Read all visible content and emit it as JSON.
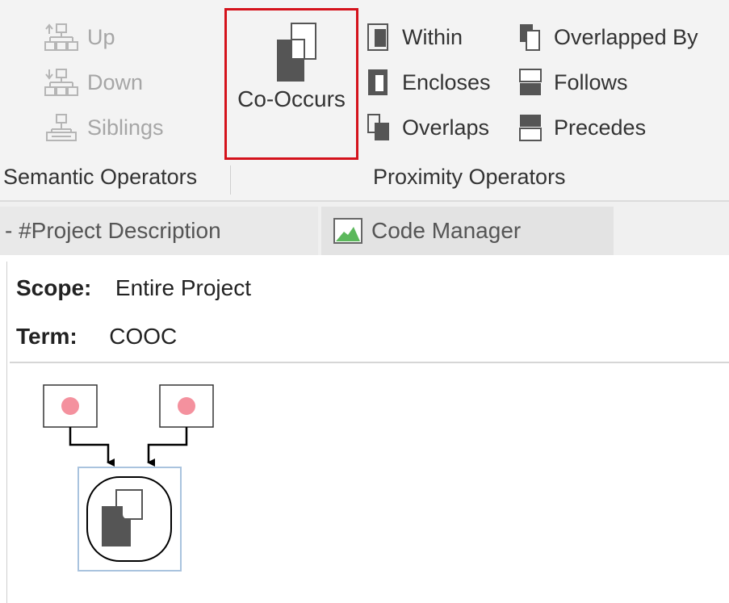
{
  "ribbon": {
    "semantic": {
      "group_label": "Semantic Operators",
      "up_label": "Up",
      "down_label": "Down",
      "siblings_label": "Siblings"
    },
    "proximity": {
      "group_label": "Proximity Operators",
      "cooccurs_label": "Co-Occurs",
      "within_label": "Within",
      "encloses_label": "Encloses",
      "overlaps_label": "Overlaps",
      "overlapped_by_label": "Overlapped By",
      "follows_label": "Follows",
      "precedes_label": "Precedes"
    }
  },
  "tabs": [
    {
      "label": "- #Project Description"
    },
    {
      "label": "Code Manager",
      "icon": "code-manager-icon"
    }
  ],
  "query": {
    "scope_key": "Scope:",
    "scope_value": "Entire Project",
    "term_key": "Term:",
    "term_value": "COOC"
  },
  "diagram": {
    "input_nodes": [
      "code-node-left",
      "code-node-right"
    ],
    "operator_node": "cooccurs-operator-icon"
  },
  "colors": {
    "highlight_border": "#d4121b",
    "node_dot": "#f4919e",
    "icon_dark": "#555555",
    "disabled_text": "#a6a6a6",
    "selection_border": "#a9c3de"
  }
}
